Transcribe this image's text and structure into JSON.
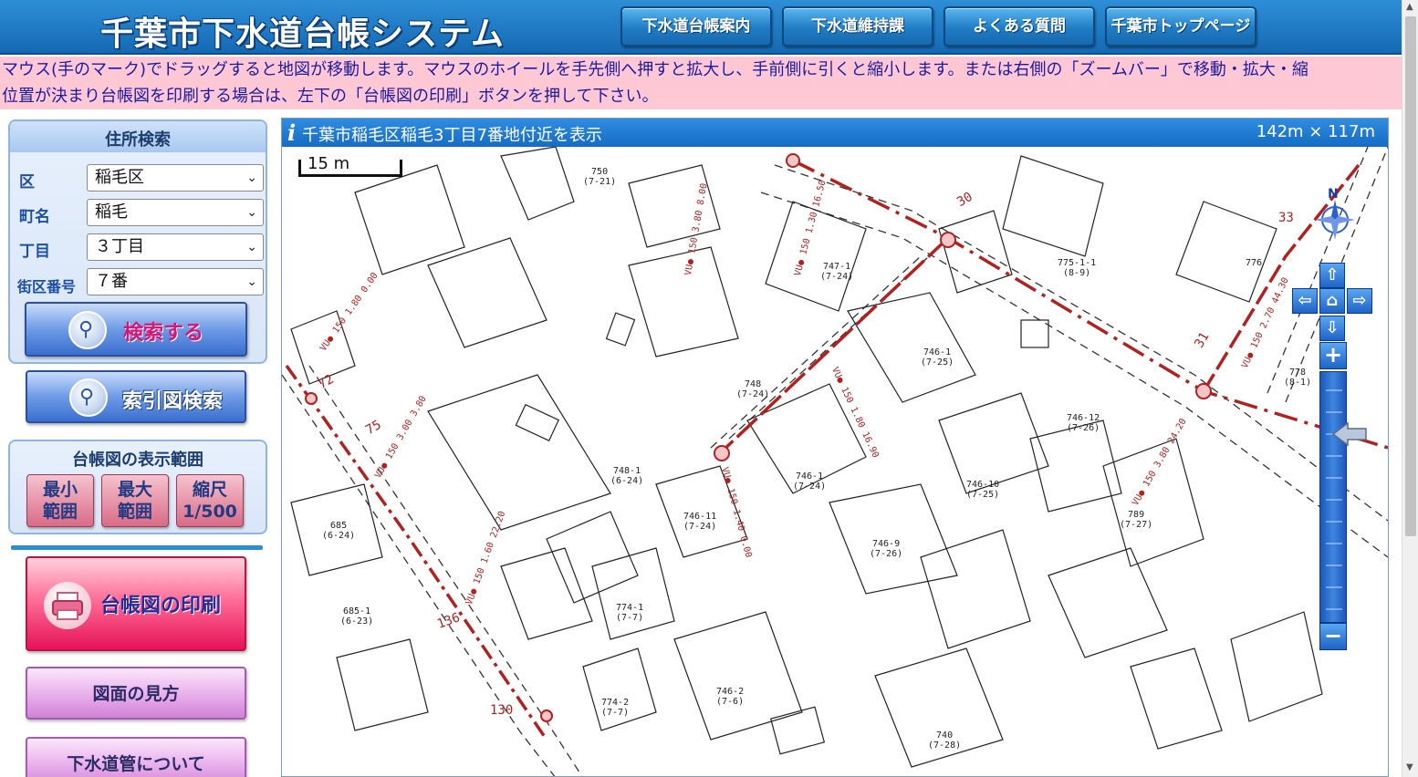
{
  "header": {
    "title": "千葉市下水道台帳システム",
    "nav": [
      {
        "label": "下水道台帳案内"
      },
      {
        "label": "下水道維持課"
      },
      {
        "label": "よくある質問"
      },
      {
        "label": "千葉市トップページ"
      }
    ]
  },
  "notice": {
    "line1": "マウス(手のマーク)でドラッグすると地図が移動します。マウスのホイールを手先側へ押すと拡大し、手前側に引くと縮小します。または右側の「ズームバー」で移動・拡大・縮",
    "line2": "位置が決まり台帳図を印刷する場合は、左下の「台帳図の印刷」ボタンを押して下さい。"
  },
  "sidebar": {
    "address_search": {
      "title": "住所検索",
      "fields": [
        {
          "label": "区",
          "value": "稲毛区"
        },
        {
          "label": "町名",
          "value": "稲毛"
        },
        {
          "label": "丁目",
          "value": "３丁目"
        },
        {
          "label": "街区番号",
          "value": "７番"
        }
      ],
      "search_button": "検索する"
    },
    "index_search_button": "索引図検索",
    "display_range": {
      "title": "台帳図の表示範囲",
      "buttons": [
        {
          "line1": "最小",
          "line2": "範囲"
        },
        {
          "line1": "最大",
          "line2": "範囲"
        },
        {
          "line1": "縮尺",
          "line2": "1/500"
        }
      ]
    },
    "print_button": "台帳図の印刷",
    "how_to_read_button": "図面の見方",
    "about_pipes_button": "下水道管について"
  },
  "map": {
    "info_icon": "i",
    "location_text": "千葉市稲毛区稲毛3丁目7番地付近を表示",
    "extent_text": "142m × 117m",
    "scale_label": "15 m",
    "compass_label": "N",
    "lot_labels": [
      {
        "id": "750",
        "sub": "(7-21)"
      },
      {
        "id": "747-1",
        "sub": "(7-24)"
      },
      {
        "id": "775-1-1",
        "sub": "(8-9)"
      },
      {
        "id": "776",
        "sub": ""
      },
      {
        "id": "746-1",
        "sub": "(7-25)"
      },
      {
        "id": "748",
        "sub": "(7-24)"
      },
      {
        "id": "778",
        "sub": "(8-1)"
      },
      {
        "id": "746-12",
        "sub": "(7-26)"
      },
      {
        "id": "748-1",
        "sub": "(6-24)"
      },
      {
        "id": "746-1",
        "sub": "(7-24)"
      },
      {
        "id": "746-10",
        "sub": "(7-25)"
      },
      {
        "id": "746-11",
        "sub": "(7-24)"
      },
      {
        "id": "789",
        "sub": "(7-27)"
      },
      {
        "id": "685",
        "sub": "(6-24)"
      },
      {
        "id": "746-9",
        "sub": "(7-26)"
      },
      {
        "id": "774-1",
        "sub": "(7-7)"
      },
      {
        "id": "685-1",
        "sub": "(6-23)"
      },
      {
        "id": "746-2",
        "sub": "(7-6)"
      },
      {
        "id": "774-2",
        "sub": "(7-7)"
      },
      {
        "id": "740",
        "sub": "(7-28)"
      }
    ],
    "pipe_labels": [
      "VU● 150 1.80 0.00",
      "VU● 150 3.00 3.80",
      "VU● 150 1.60 22.20",
      "VU● 150 1.80 16.90",
      "VU● 150 1.40 0.00",
      "VU● 150 3.80 8.00",
      "VU● 150 1.30 16.50",
      "VU● 150 2.70 44.30",
      "VU● 150 3.80 24.20"
    ],
    "pipe_numbers": [
      "72",
      "75",
      "30",
      "33",
      "31",
      "136",
      "130"
    ]
  },
  "zoom": {
    "level_fraction": 0.25
  }
}
